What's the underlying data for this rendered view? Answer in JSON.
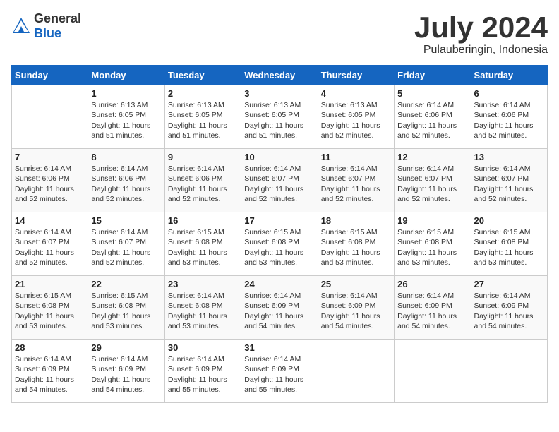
{
  "logo": {
    "general": "General",
    "blue": "Blue"
  },
  "title": "July 2024",
  "subtitle": "Pulauberingin, Indonesia",
  "days_of_week": [
    "Sunday",
    "Monday",
    "Tuesday",
    "Wednesday",
    "Thursday",
    "Friday",
    "Saturday"
  ],
  "weeks": [
    [
      {
        "day": "",
        "info": ""
      },
      {
        "day": "1",
        "info": "Sunrise: 6:13 AM\nSunset: 6:05 PM\nDaylight: 11 hours\nand 51 minutes."
      },
      {
        "day": "2",
        "info": "Sunrise: 6:13 AM\nSunset: 6:05 PM\nDaylight: 11 hours\nand 51 minutes."
      },
      {
        "day": "3",
        "info": "Sunrise: 6:13 AM\nSunset: 6:05 PM\nDaylight: 11 hours\nand 51 minutes."
      },
      {
        "day": "4",
        "info": "Sunrise: 6:13 AM\nSunset: 6:05 PM\nDaylight: 11 hours\nand 52 minutes."
      },
      {
        "day": "5",
        "info": "Sunrise: 6:14 AM\nSunset: 6:06 PM\nDaylight: 11 hours\nand 52 minutes."
      },
      {
        "day": "6",
        "info": "Sunrise: 6:14 AM\nSunset: 6:06 PM\nDaylight: 11 hours\nand 52 minutes."
      }
    ],
    [
      {
        "day": "7",
        "info": "Sunrise: 6:14 AM\nSunset: 6:06 PM\nDaylight: 11 hours\nand 52 minutes."
      },
      {
        "day": "8",
        "info": "Sunrise: 6:14 AM\nSunset: 6:06 PM\nDaylight: 11 hours\nand 52 minutes."
      },
      {
        "day": "9",
        "info": "Sunrise: 6:14 AM\nSunset: 6:06 PM\nDaylight: 11 hours\nand 52 minutes."
      },
      {
        "day": "10",
        "info": "Sunrise: 6:14 AM\nSunset: 6:07 PM\nDaylight: 11 hours\nand 52 minutes."
      },
      {
        "day": "11",
        "info": "Sunrise: 6:14 AM\nSunset: 6:07 PM\nDaylight: 11 hours\nand 52 minutes."
      },
      {
        "day": "12",
        "info": "Sunrise: 6:14 AM\nSunset: 6:07 PM\nDaylight: 11 hours\nand 52 minutes."
      },
      {
        "day": "13",
        "info": "Sunrise: 6:14 AM\nSunset: 6:07 PM\nDaylight: 11 hours\nand 52 minutes."
      }
    ],
    [
      {
        "day": "14",
        "info": "Sunrise: 6:14 AM\nSunset: 6:07 PM\nDaylight: 11 hours\nand 52 minutes."
      },
      {
        "day": "15",
        "info": "Sunrise: 6:14 AM\nSunset: 6:07 PM\nDaylight: 11 hours\nand 52 minutes."
      },
      {
        "day": "16",
        "info": "Sunrise: 6:15 AM\nSunset: 6:08 PM\nDaylight: 11 hours\nand 53 minutes."
      },
      {
        "day": "17",
        "info": "Sunrise: 6:15 AM\nSunset: 6:08 PM\nDaylight: 11 hours\nand 53 minutes."
      },
      {
        "day": "18",
        "info": "Sunrise: 6:15 AM\nSunset: 6:08 PM\nDaylight: 11 hours\nand 53 minutes."
      },
      {
        "day": "19",
        "info": "Sunrise: 6:15 AM\nSunset: 6:08 PM\nDaylight: 11 hours\nand 53 minutes."
      },
      {
        "day": "20",
        "info": "Sunrise: 6:15 AM\nSunset: 6:08 PM\nDaylight: 11 hours\nand 53 minutes."
      }
    ],
    [
      {
        "day": "21",
        "info": "Sunrise: 6:15 AM\nSunset: 6:08 PM\nDaylight: 11 hours\nand 53 minutes."
      },
      {
        "day": "22",
        "info": "Sunrise: 6:15 AM\nSunset: 6:08 PM\nDaylight: 11 hours\nand 53 minutes."
      },
      {
        "day": "23",
        "info": "Sunrise: 6:14 AM\nSunset: 6:08 PM\nDaylight: 11 hours\nand 53 minutes."
      },
      {
        "day": "24",
        "info": "Sunrise: 6:14 AM\nSunset: 6:09 PM\nDaylight: 11 hours\nand 54 minutes."
      },
      {
        "day": "25",
        "info": "Sunrise: 6:14 AM\nSunset: 6:09 PM\nDaylight: 11 hours\nand 54 minutes."
      },
      {
        "day": "26",
        "info": "Sunrise: 6:14 AM\nSunset: 6:09 PM\nDaylight: 11 hours\nand 54 minutes."
      },
      {
        "day": "27",
        "info": "Sunrise: 6:14 AM\nSunset: 6:09 PM\nDaylight: 11 hours\nand 54 minutes."
      }
    ],
    [
      {
        "day": "28",
        "info": "Sunrise: 6:14 AM\nSunset: 6:09 PM\nDaylight: 11 hours\nand 54 minutes."
      },
      {
        "day": "29",
        "info": "Sunrise: 6:14 AM\nSunset: 6:09 PM\nDaylight: 11 hours\nand 54 minutes."
      },
      {
        "day": "30",
        "info": "Sunrise: 6:14 AM\nSunset: 6:09 PM\nDaylight: 11 hours\nand 55 minutes."
      },
      {
        "day": "31",
        "info": "Sunrise: 6:14 AM\nSunset: 6:09 PM\nDaylight: 11 hours\nand 55 minutes."
      },
      {
        "day": "",
        "info": ""
      },
      {
        "day": "",
        "info": ""
      },
      {
        "day": "",
        "info": ""
      }
    ]
  ]
}
